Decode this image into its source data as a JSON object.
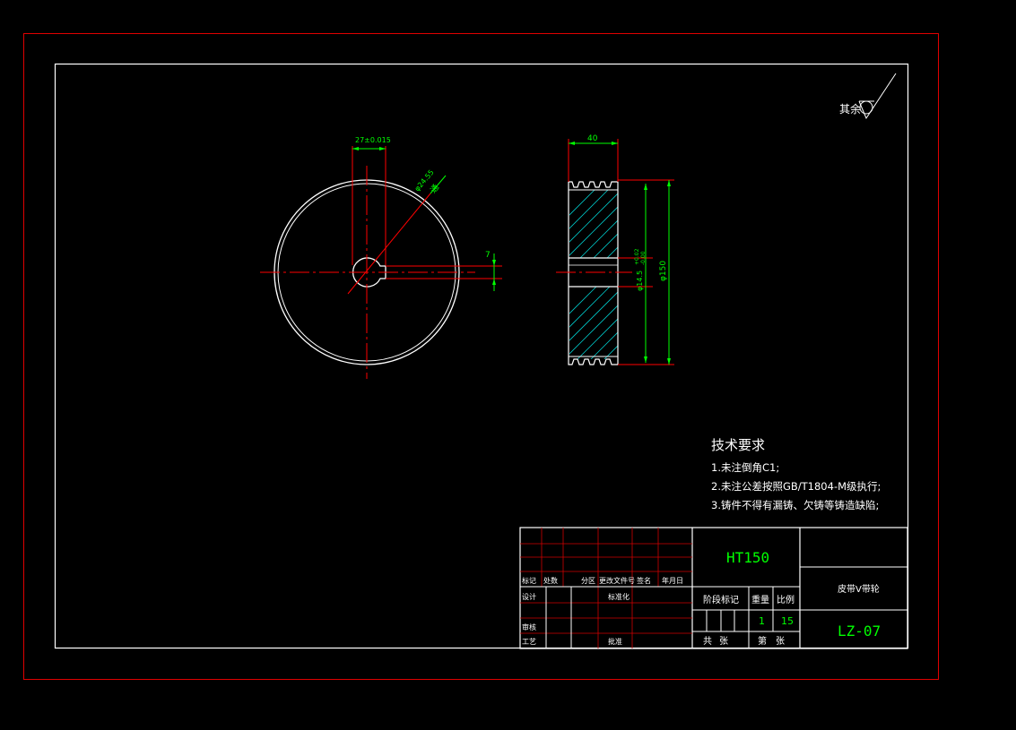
{
  "roughness_label": "其余",
  "dims": {
    "keyway_width": "27±0.015",
    "outer_dia": "φ24.55",
    "bore_note": "通",
    "key_depth": "7",
    "hub_width": "40",
    "bore_dia": "φ14.5",
    "bore_tol": "+0.02",
    "bore_tol2": "-0.00",
    "pulley_dia": "φ150"
  },
  "notes": {
    "heading": "技术要求",
    "items": [
      "1.未注倒角C1;",
      "2.未注公差按照GB/T1804-M级执行;",
      "3.铸件不得有漏铸、欠铸等铸造缺陷;"
    ]
  },
  "title_block": {
    "material": "HT150",
    "part_name": "皮带V带轮",
    "drawing_no": "LZ-07",
    "qty": "1",
    "scale": "15",
    "sheet_label": "第",
    "sheet_unit": "张",
    "total_label": "共",
    "total_unit": "张",
    "stage_mark_label": "阶段标记",
    "weight_label": "重量",
    "scale_label": "比例",
    "rev_cols": [
      "标记",
      "处数",
      "分区",
      "更改文件号",
      "签名",
      "年月日"
    ],
    "design_label": "设计",
    "std_label": "标准化",
    "review_label": "审核",
    "process_label": "工艺",
    "approve_label": "批准"
  },
  "colors": {
    "border_outer": "#e00000",
    "frame": "#ffffff",
    "dim": "#00ff00",
    "center": "#ff0000",
    "hatch": "#00c8c8",
    "text": "#ffffff",
    "table": "#d00000"
  }
}
